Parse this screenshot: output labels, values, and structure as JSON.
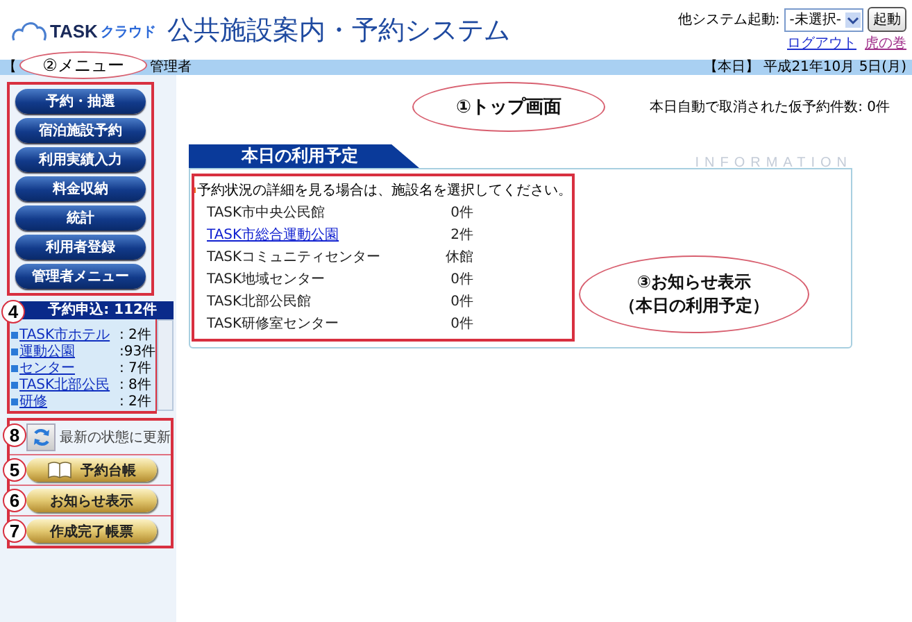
{
  "header": {
    "brand": "TASK",
    "brand_sub": "クラウド",
    "title": "公共施設案内・予約システム",
    "launcher_label": "他システム起動:",
    "launcher_select": "-未選択-",
    "launcher_button": "起動",
    "links": [
      "ログアウト",
      "虎の巻"
    ]
  },
  "user_bar": {
    "user_start": "【",
    "user_end": "管理者",
    "date": "【本日】 平成21年10月 5日(月)"
  },
  "menu": {
    "callout": "②メニュー",
    "items": [
      "予約・抽選",
      "宿泊施設予約",
      "利用実績入力",
      "料金収納",
      "統計",
      "利用者登録",
      "管理者メニュー"
    ]
  },
  "reservations": {
    "callout": "4",
    "title": "予約申込: 112件",
    "items": [
      {
        "name": "TASK市ホテル",
        "count": ": 2件"
      },
      {
        "name": "運動公園",
        "count": ":93件"
      },
      {
        "name": "センター",
        "count": ": 7件"
      },
      {
        "name": "TASK北部公民",
        "count": ": 8件"
      },
      {
        "name": "研修",
        "count": ": 2件"
      }
    ]
  },
  "actions": [
    {
      "kind": "refresh",
      "callout": "8",
      "label": "最新の状態に更新"
    },
    {
      "kind": "book",
      "callout": "5",
      "label": "予約台帳"
    },
    {
      "kind": "plain",
      "callout": "6",
      "label": "お知らせ表示"
    },
    {
      "kind": "plain",
      "callout": "7",
      "label": "作成完了帳票"
    }
  ],
  "top": {
    "callout": "①トップ画面",
    "cancelled_notice": "本日自動で取消された仮予約件数: 0件"
  },
  "schedule": {
    "tab": "本日の利用予定",
    "watermark": "INFORMATION",
    "hint": "予約状況の詳細を見る場合は、施設名を選択してください。",
    "callout": [
      "③お知らせ表示",
      "（本日の利用予定）"
    ],
    "rows": [
      {
        "name": "TASK市中央公民館",
        "count": "0件",
        "link": false
      },
      {
        "name": "TASK市総合運動公園",
        "count": "2件",
        "link": true
      },
      {
        "name": "TASKコミュニティセンター",
        "count": "休館",
        "link": false
      },
      {
        "name": "TASK地域センター",
        "count": "0件",
        "link": false
      },
      {
        "name": "TASK北部公民館",
        "count": "0件",
        "link": false
      },
      {
        "name": "TASK研修室センター",
        "count": "0件",
        "link": false
      }
    ]
  }
}
